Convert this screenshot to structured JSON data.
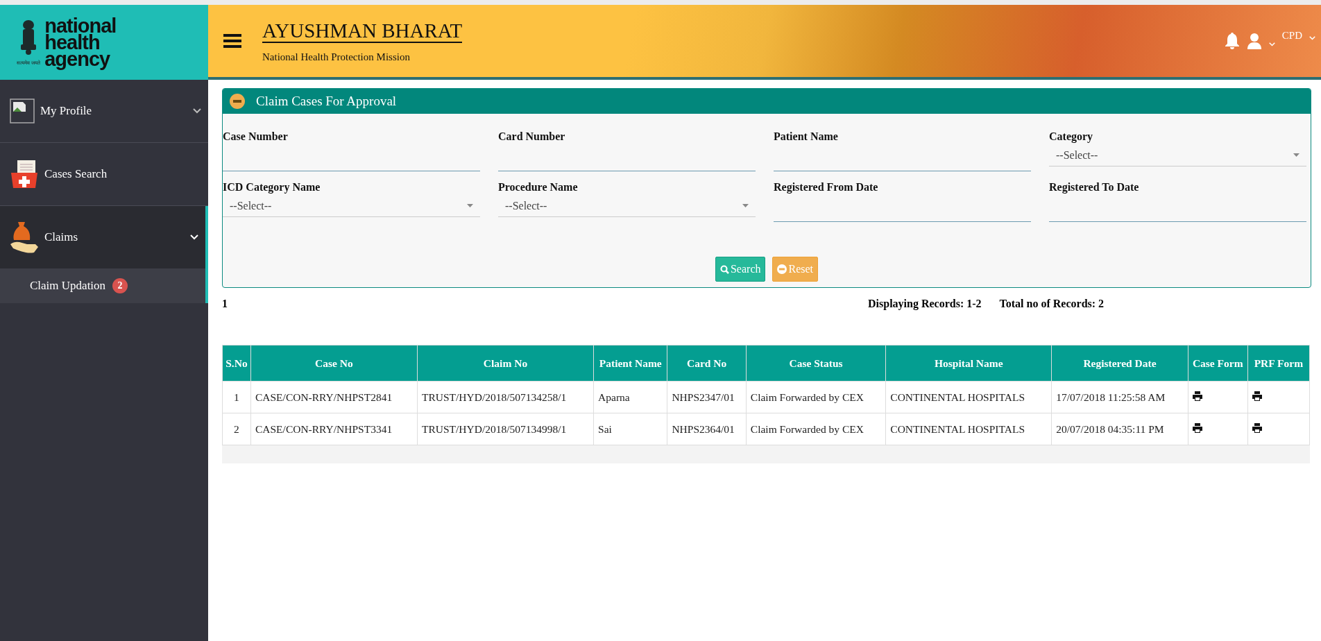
{
  "logo": {
    "lines": [
      "national",
      "health",
      "agency"
    ],
    "motto": "सत्यमेव जयते"
  },
  "header": {
    "title": "AYUSHMAN BHARAT",
    "subtitle": "National Health Protection Mission",
    "user": "CPD"
  },
  "sidebar": {
    "items": [
      {
        "label": "My Profile",
        "kind": "profile",
        "expanded": false,
        "selected": false
      },
      {
        "label": "Cases Search",
        "kind": "search",
        "selected": false
      },
      {
        "label": "Claims",
        "kind": "claims",
        "expanded": true,
        "selected": true,
        "children": [
          {
            "label": "Claim Updation",
            "badge": "2",
            "selected": true
          }
        ]
      }
    ]
  },
  "panel": {
    "title": "Claim Cases For Approval",
    "expanded": true,
    "fields": [
      {
        "label": "Case Number",
        "kind": "text"
      },
      {
        "label": "Card Number",
        "kind": "text"
      },
      {
        "label": "Patient Name",
        "kind": "text"
      },
      {
        "label": "Category",
        "kind": "select",
        "value": "--Select--"
      },
      {
        "label": "ICD Category Name",
        "kind": "select",
        "value": "--Select--"
      },
      {
        "label": "Procedure Name",
        "kind": "select",
        "value": "--Select--"
      },
      {
        "label": "Registered From Date",
        "kind": "text"
      },
      {
        "label": "Registered To Date",
        "kind": "text"
      }
    ],
    "buttons": [
      {
        "label": "Search",
        "kind": "search"
      },
      {
        "label": "Reset",
        "kind": "reset"
      }
    ]
  },
  "pager": {
    "page": "1",
    "displaying": "Displaying Records: 1-2",
    "total": "Total no of Records: 2"
  },
  "table": {
    "columns": [
      {
        "label": "S.No",
        "kind": "text"
      },
      {
        "label": "Case No",
        "kind": "text"
      },
      {
        "label": "Claim No",
        "kind": "text"
      },
      {
        "label": "Patient Name",
        "kind": "text"
      },
      {
        "label": "Card No",
        "kind": "text"
      },
      {
        "label": "Case Status",
        "kind": "text"
      },
      {
        "label": "Hospital Name",
        "kind": "text"
      },
      {
        "label": "Registered Date",
        "kind": "text"
      },
      {
        "label": "Case Form",
        "kind": "print"
      },
      {
        "label": "PRF Form",
        "kind": "print"
      }
    ],
    "rows": [
      [
        "1",
        "CASE/CON-RRY/NHPST2841",
        "TRUST/HYD/2018/507134258/1",
        "Aparna",
        "NHPS2347/01",
        "Claim Forwarded by CEX",
        "CONTINENTAL HOSPITALS",
        "17/07/2018 11:25:58 AM"
      ],
      [
        "2",
        "CASE/CON-RRY/NHPST3341",
        "TRUST/HYD/2018/507134998/1",
        "Sai",
        "NHPS2364/01",
        "Claim Forwarded by CEX",
        "CONTINENTAL HOSPITALS",
        "20/07/2018 04:35:11 PM"
      ]
    ]
  }
}
